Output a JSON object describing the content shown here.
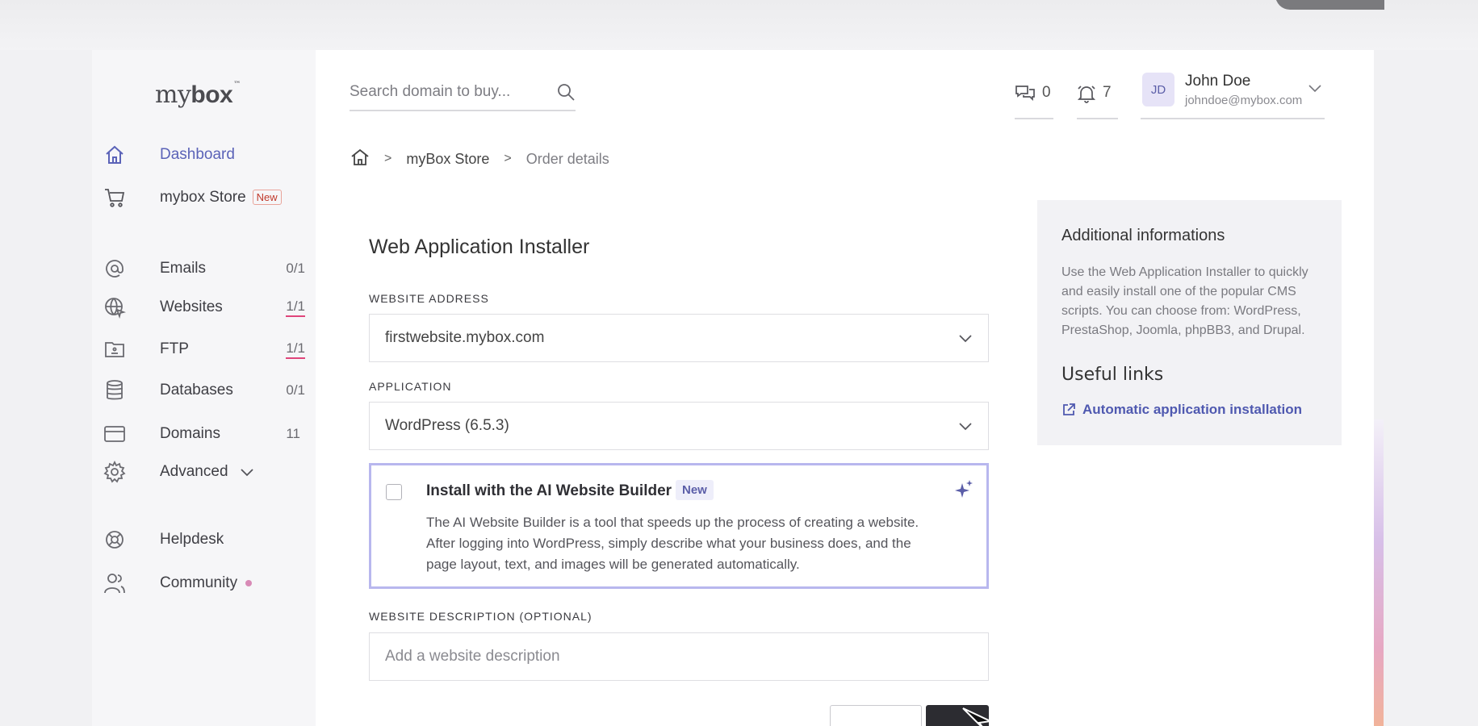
{
  "brand": {
    "logo_main": "my",
    "logo_bold": "box",
    "logo_tm": "™"
  },
  "search": {
    "placeholder": "Search domain to buy..."
  },
  "header": {
    "messages_count": "0",
    "notifications_count": "7",
    "user": {
      "initials": "JD",
      "name": "John Doe",
      "email": "johndoe@mybox.com"
    }
  },
  "sidebar": {
    "dashboard": "Dashboard",
    "store": "mybox Store",
    "store_badge": "New",
    "emails": {
      "label": "Emails",
      "count": "0/1"
    },
    "websites": {
      "label": "Websites",
      "count": "1/1"
    },
    "ftp": {
      "label": "FTP",
      "count": "1/1"
    },
    "databases": {
      "label": "Databases",
      "count": "0/1"
    },
    "domains": {
      "label": "Domains",
      "count": "11"
    },
    "advanced": "Advanced",
    "helpdesk": "Helpdesk",
    "community": "Community"
  },
  "breadcrumb": {
    "store": "myBox Store",
    "current": "Order details"
  },
  "form": {
    "title": "Web Application Installer",
    "website_address_label": "WEBSITE ADDRESS",
    "website_address_value": "firstwebsite.mybox.com",
    "application_label": "APPLICATION",
    "application_value": "WordPress (6.5.3)",
    "ai_title": "Install with the AI Website Builder",
    "ai_badge": "New",
    "ai_description": "The AI Website Builder is a tool that speeds up the process of creating a website. After logging into WordPress, simply describe what your business does, and the page layout, text, and images will be generated automatically.",
    "description_label": "WEBSITE DESCRIPTION (OPTIONAL)",
    "description_placeholder": "Add a website description"
  },
  "info": {
    "title": "Additional informations",
    "text": "Use the Web Application Installer to quickly and easily install one of the popular CMS scripts. You can choose from: WordPress, PrestaShop, Joomla, phpBB3, and Drupal.",
    "links_title": "Useful links",
    "link_label": "Automatic application installation"
  },
  "colors": {
    "accent": "#5b63b8",
    "ai_border": "#b8b7ee",
    "underline": "#e0457b"
  }
}
